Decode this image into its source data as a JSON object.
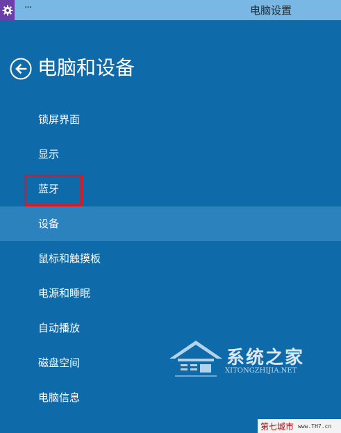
{
  "titlebar": {
    "app_icon": "gear-icon",
    "more_label": "···",
    "title": "电脑设置"
  },
  "header": {
    "back_icon": "back-arrow-icon",
    "title": "电脑和设备"
  },
  "nav": {
    "items": [
      {
        "label": "锁屏界面",
        "selected": false
      },
      {
        "label": "显示",
        "selected": false
      },
      {
        "label": "蓝牙",
        "selected": false,
        "highlighted": true
      },
      {
        "label": "设备",
        "selected": true
      },
      {
        "label": "鼠标和触摸板",
        "selected": false
      },
      {
        "label": "电源和睡眠",
        "selected": false
      },
      {
        "label": "自动播放",
        "selected": false
      },
      {
        "label": "磁盘空间",
        "selected": false
      },
      {
        "label": "电脑信息",
        "selected": false
      }
    ]
  },
  "watermark": {
    "cn": "系统之家",
    "en": "XITONGZHIJIA.NET"
  },
  "corner_mark": {
    "cn": "第七城市",
    "en": "www.TH7.cn"
  },
  "colors": {
    "background": "#0e6aa8",
    "titlebar": "#79b8e4",
    "selected": "#2b82bc",
    "highlight_border": "#e2141e",
    "app_icon_bg": "#6a3fa8"
  }
}
